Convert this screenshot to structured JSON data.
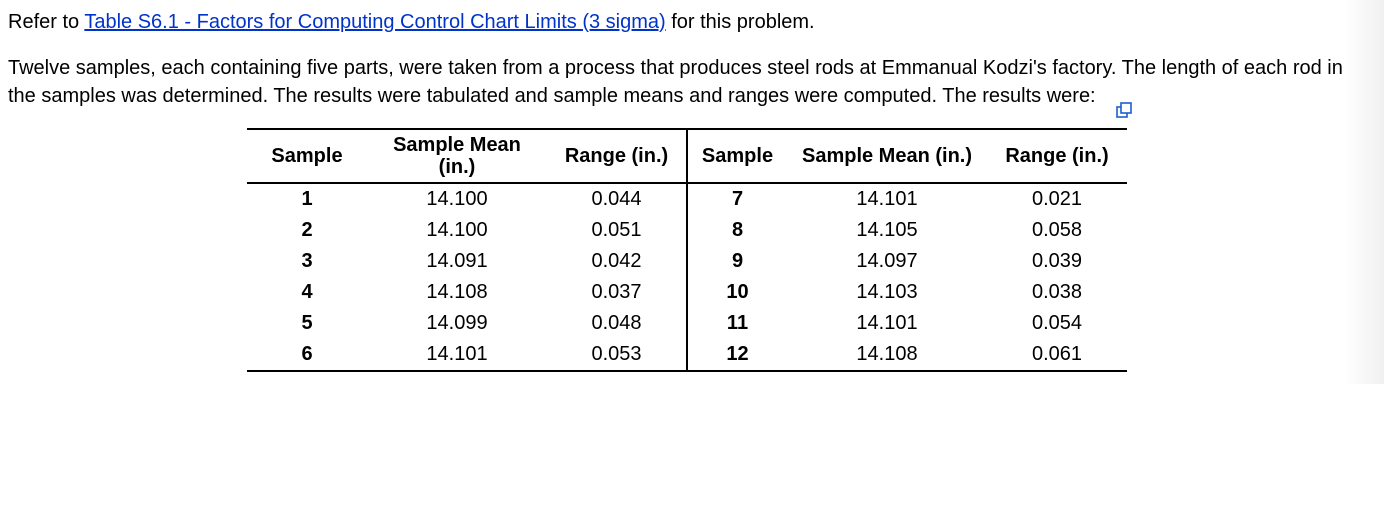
{
  "intro": {
    "prefix": "Refer to ",
    "link_text": "Table S6.1 - Factors for Computing Control Chart Limits (3 sigma)",
    "suffix": " for this problem."
  },
  "paragraph": "Twelve samples, each containing five parts, were taken from a process that produces steel rods at Emmanual Kodzi's factory. The length of each rod in the samples was determined. The results were tabulated and sample means and ranges were computed. The results were:",
  "headers": {
    "sample_left": "Sample",
    "mean_left_l1": "Sample Mean",
    "mean_left_l2": "(in.)",
    "range_left": "Range (in.)",
    "sample_right": "Sample",
    "mean_right": "Sample Mean (in.)",
    "range_right": "Range (in.)"
  },
  "rows": [
    {
      "s1": "1",
      "m1": "14.100",
      "r1": "0.044",
      "s2": "7",
      "m2": "14.101",
      "r2": "0.021"
    },
    {
      "s1": "2",
      "m1": "14.100",
      "r1": "0.051",
      "s2": "8",
      "m2": "14.105",
      "r2": "0.058"
    },
    {
      "s1": "3",
      "m1": "14.091",
      "r1": "0.042",
      "s2": "9",
      "m2": "14.097",
      "r2": "0.039"
    },
    {
      "s1": "4",
      "m1": "14.108",
      "r1": "0.037",
      "s2": "10",
      "m2": "14.103",
      "r2": "0.038"
    },
    {
      "s1": "5",
      "m1": "14.099",
      "r1": "0.048",
      "s2": "11",
      "m2": "14.101",
      "r2": "0.054"
    },
    {
      "s1": "6",
      "m1": "14.101",
      "r1": "0.053",
      "s2": "12",
      "m2": "14.108",
      "r2": "0.061"
    }
  ],
  "chart_data": {
    "type": "table",
    "title": "Sample means and ranges",
    "columns": [
      "Sample",
      "Sample Mean (in.)",
      "Range (in.)"
    ],
    "data": [
      [
        1,
        14.1,
        0.044
      ],
      [
        2,
        14.1,
        0.051
      ],
      [
        3,
        14.091,
        0.042
      ],
      [
        4,
        14.108,
        0.037
      ],
      [
        5,
        14.099,
        0.048
      ],
      [
        6,
        14.101,
        0.053
      ],
      [
        7,
        14.101,
        0.021
      ],
      [
        8,
        14.105,
        0.058
      ],
      [
        9,
        14.097,
        0.039
      ],
      [
        10,
        14.103,
        0.038
      ],
      [
        11,
        14.101,
        0.054
      ],
      [
        12,
        14.108,
        0.061
      ]
    ]
  }
}
